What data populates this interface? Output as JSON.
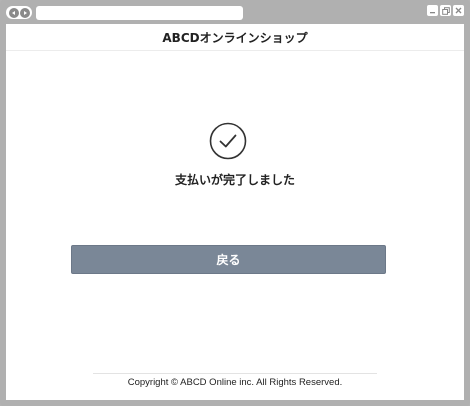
{
  "browser": {
    "back_icon": "back-arrow-icon",
    "forward_icon": "forward-arrow-icon",
    "window_buttons": {
      "minimize": "minimize-icon",
      "restore": "restore-icon",
      "close": "close-icon"
    }
  },
  "header": {
    "title": "ABCDオンラインショップ"
  },
  "main": {
    "status_icon": "check-circle-icon",
    "message": "支払いが完了しました",
    "back_button_label": "戻る"
  },
  "footer": {
    "copyright": "Copyright © ABCD Online inc. All Rights Reserved."
  },
  "colors": {
    "button": "#7a8797",
    "chrome": "#b0b0b0",
    "text": "#222222"
  }
}
